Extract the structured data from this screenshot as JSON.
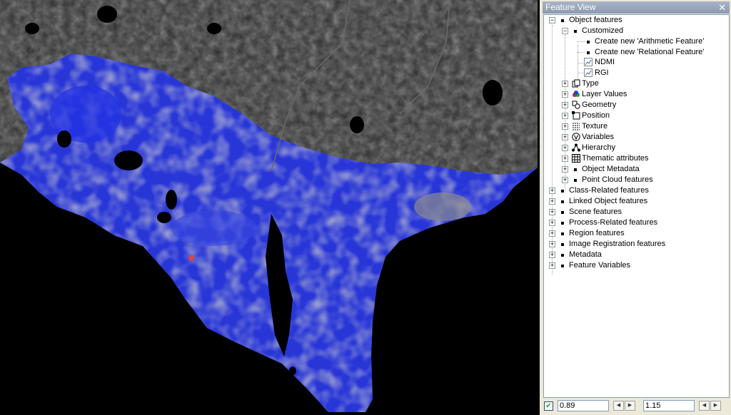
{
  "panel": {
    "title": "Feature View",
    "close_glyph": "✕"
  },
  "tree": {
    "object_features": "Object features",
    "customized": "Customized",
    "create_arithmetic": "Create new 'Arithmetic Feature'",
    "create_relational": "Create new 'Relational Feature'",
    "ndmi": "NDMI",
    "rgi": "RGI",
    "type": "Type",
    "layer_values": "Layer Values",
    "geometry": "Geometry",
    "position": "Position",
    "texture": "Texture",
    "variables": "Variables",
    "hierarchy": "Hierarchy",
    "thematic_attributes": "Thematic attributes",
    "object_metadata": "Object Metadata",
    "point_cloud_features": "Point Cloud features",
    "class_related": "Class-Related features",
    "linked_object": "Linked Object features",
    "scene": "Scene features",
    "process_related": "Process-Related features",
    "region": "Region features",
    "image_registration": "Image Registration features",
    "metadata": "Metadata",
    "feature_variables": "Feature Variables"
  },
  "bottom": {
    "checkbox_checked": true,
    "min_value": "0.89",
    "max_value": "1.15"
  },
  "icons": {
    "expanded": "minus-icon",
    "collapsed": "plus-icon"
  }
}
